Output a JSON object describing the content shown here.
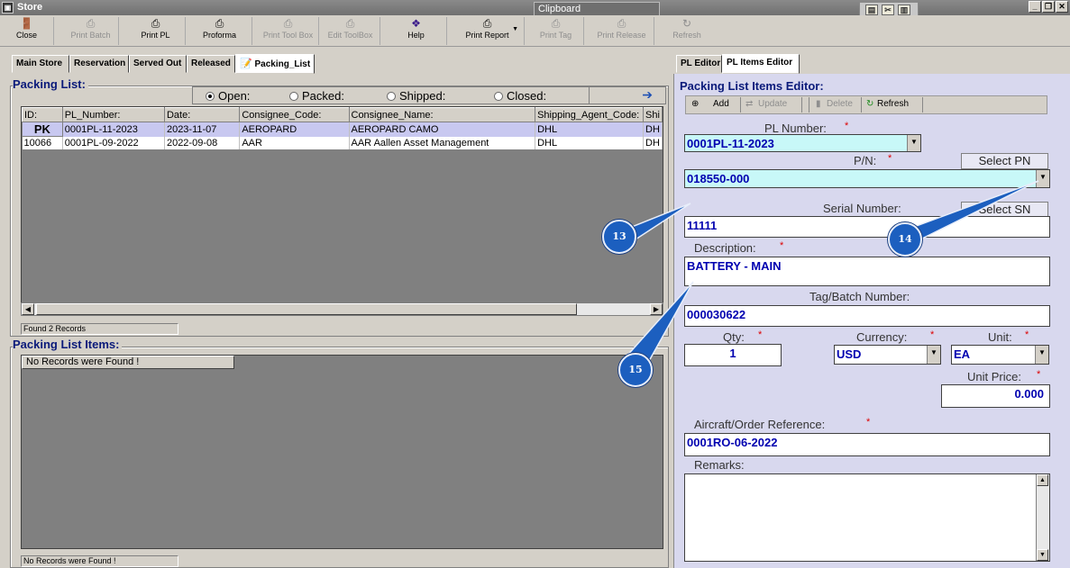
{
  "window": {
    "title": "Store",
    "clipboard_label": "Clipboard"
  },
  "toolbar": [
    {
      "label": "Close",
      "icon": "close-door-icon",
      "enabled": true
    },
    {
      "label": "Print Batch",
      "icon": "printer-icon",
      "enabled": false
    },
    {
      "label": "Print PL",
      "icon": "printer-icon",
      "enabled": true
    },
    {
      "label": "Proforma",
      "icon": "printer-icon",
      "enabled": true
    },
    {
      "label": "Print Tool Box",
      "icon": "printer-icon",
      "enabled": false
    },
    {
      "label": "Edit ToolBox",
      "icon": "printer-icon",
      "enabled": false
    },
    {
      "label": "Help",
      "icon": "help-book-icon",
      "enabled": true
    },
    {
      "label": "Print Report",
      "icon": "printer-icon",
      "enabled": true
    },
    {
      "label": "Print Tag",
      "icon": "printer-icon",
      "enabled": false
    },
    {
      "label": "Print Release",
      "icon": "printer-icon",
      "enabled": false
    },
    {
      "label": "Refresh",
      "icon": "refresh-icon",
      "enabled": false
    }
  ],
  "left_tabs": [
    "Main Store",
    "Reservation",
    "Served Out",
    "Released",
    "Packing_List"
  ],
  "right_tabs": [
    "PL Editor",
    "PL Items Editor"
  ],
  "packing_list": {
    "title": "Packing List:",
    "filters": [
      "Open:",
      "Packed:",
      "Shipped:",
      "Closed:"
    ],
    "selected_filter": "Open:",
    "columns": [
      "ID:",
      "PL_Number:",
      "Date:",
      "Consignee_Code:",
      "Consignee_Name:",
      "Shipping_Agent_Code:",
      "Shi"
    ],
    "rows": [
      {
        "id": "PK",
        "pl_number": "0001PL-11-2023",
        "date": "2023-11-07",
        "consignee_code": "AEROPARD",
        "consignee_name": "AEROPARD CAMO",
        "agent": "DHL",
        "shi": "DH"
      },
      {
        "id": "10066",
        "pl_number": "0001PL-09-2022",
        "date": "2022-09-08",
        "consignee_code": "AAR",
        "consignee_name": "AAR Aallen Asset Management",
        "agent": "DHL",
        "shi": "DH"
      }
    ],
    "status": "Found 2 Records"
  },
  "packing_list_items": {
    "title": "Packing List Items:",
    "empty_message": "No Records were Found !",
    "status": "No Records were Found !"
  },
  "editor": {
    "title": "Packing List Items Editor:",
    "toolbar": {
      "add": "Add",
      "update": "Update",
      "delete": "Delete",
      "refresh": "Refresh"
    },
    "pl_number_label": "PL Number:",
    "pl_number": "0001PL-11-2023",
    "pn_label": "P/N:",
    "pn": "018550-000",
    "select_pn": "Select PN",
    "serial_label": "Serial Number:",
    "serial": "11111",
    "select_sn": "Select SN",
    "description_label": "Description:",
    "description": "BATTERY - MAIN",
    "tag_label": "Tag/Batch Number:",
    "tag": "000030622",
    "qty_label": "Qty:",
    "qty": "1",
    "currency_label": "Currency:",
    "currency": "USD",
    "unit_label": "Unit:",
    "unit": "EA",
    "unit_price_label": "Unit Price:",
    "unit_price": "0.000",
    "aircraft_label": "Aircraft/Order Reference:",
    "aircraft": "0001RO-06-2022",
    "remarks_label": "Remarks:",
    "required_mark": "*"
  },
  "callouts": [
    "13",
    "14",
    "15"
  ],
  "colors": {
    "title_blue": "#0a1a7a",
    "field_value": "#0000b0",
    "cyan_field": "#c8f8f8",
    "panel": "#d8d8ee",
    "callout": "#1c5fbf"
  }
}
